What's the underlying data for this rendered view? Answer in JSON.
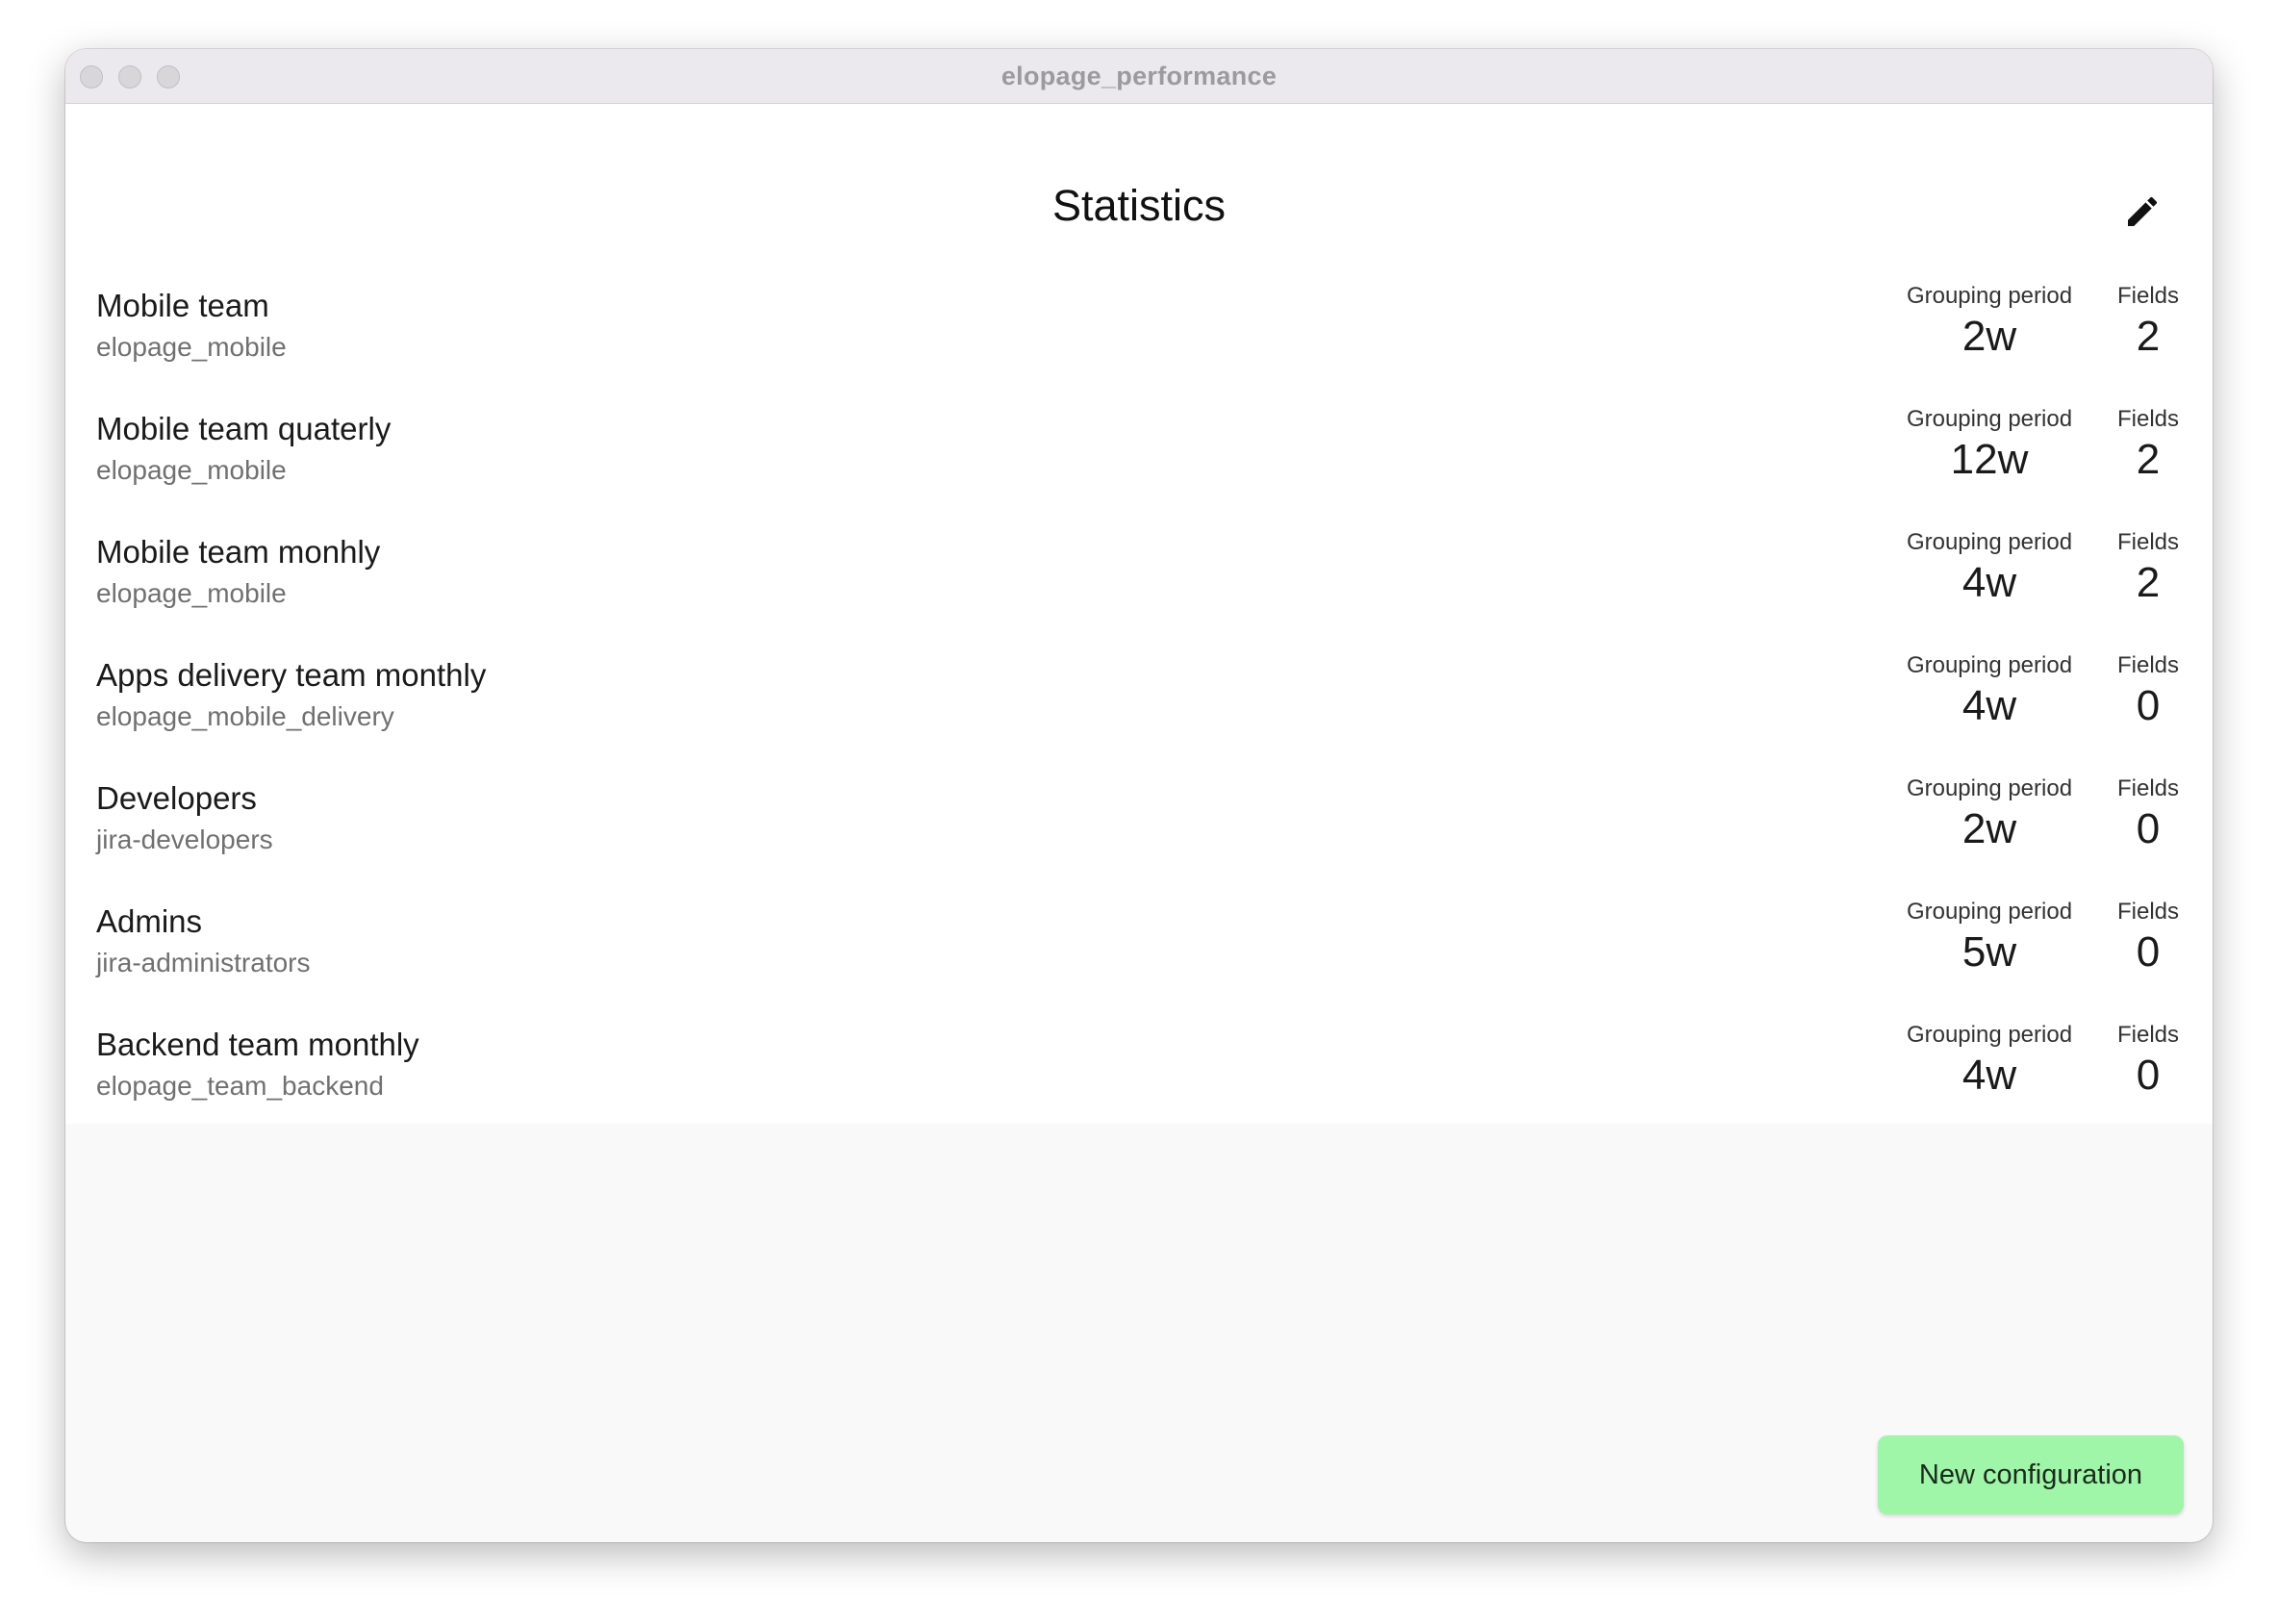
{
  "window": {
    "title": "elopage_performance"
  },
  "header": {
    "title": "Statistics"
  },
  "labels": {
    "grouping_period": "Grouping period",
    "fields": "Fields"
  },
  "configs": [
    {
      "name": "Mobile team",
      "group": "elopage_mobile",
      "grouping_period": "2w",
      "fields": "2"
    },
    {
      "name": "Mobile team quaterly",
      "group": "elopage_mobile",
      "grouping_period": "12w",
      "fields": "2"
    },
    {
      "name": "Mobile team monhly",
      "group": "elopage_mobile",
      "grouping_period": "4w",
      "fields": "2"
    },
    {
      "name": "Apps delivery team monthly",
      "group": "elopage_mobile_delivery",
      "grouping_period": "4w",
      "fields": "0"
    },
    {
      "name": "Developers",
      "group": "jira-developers",
      "grouping_period": "2w",
      "fields": "0"
    },
    {
      "name": "Admins",
      "group": "jira-administrators",
      "grouping_period": "5w",
      "fields": "0"
    },
    {
      "name": "Backend team monthly",
      "group": "elopage_team_backend",
      "grouping_period": "4w",
      "fields": "0"
    }
  ],
  "footer": {
    "new_configuration_label": "New configuration"
  },
  "icons": {
    "edit": "pencil-icon"
  },
  "colors": {
    "accent_button": "#9ff5a8",
    "titlebar": "#ece9ee",
    "background": "#f9f9f9"
  }
}
